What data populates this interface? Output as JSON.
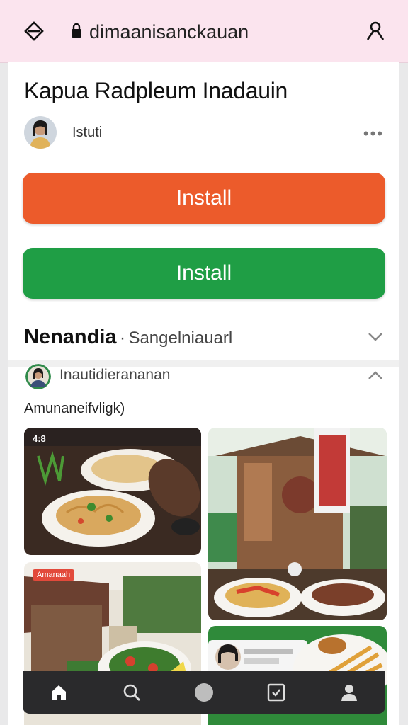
{
  "browser": {
    "url": "dimaanisanckauan",
    "left_icon": "diamond-icon",
    "lock_icon": "lock-icon",
    "right_icon": "profile-switch-icon"
  },
  "page": {
    "title": "Kapua Radpleum Inadauin",
    "author": "Istuti",
    "more_label": "•••"
  },
  "buttons": {
    "install_primary": "Install",
    "install_secondary": "Install"
  },
  "section": {
    "bold": "Nenandia",
    "separator": "·",
    "sub": "Sangelniauarl",
    "subrow_name": "Inautidierananan",
    "subheading": "Amunaneifvligk)"
  },
  "tiles": {
    "tile1_status": "4:8",
    "tile3_badge": "Amanaah"
  },
  "nav": {
    "items": [
      "home-icon",
      "search-icon",
      "circle-icon",
      "checkbox-icon",
      "profile-icon"
    ]
  },
  "colors": {
    "topbar": "#fbe4ee",
    "install_orange": "#ec5b2b",
    "install_green": "#1f9e45",
    "navbar": "#2a2a2c"
  }
}
